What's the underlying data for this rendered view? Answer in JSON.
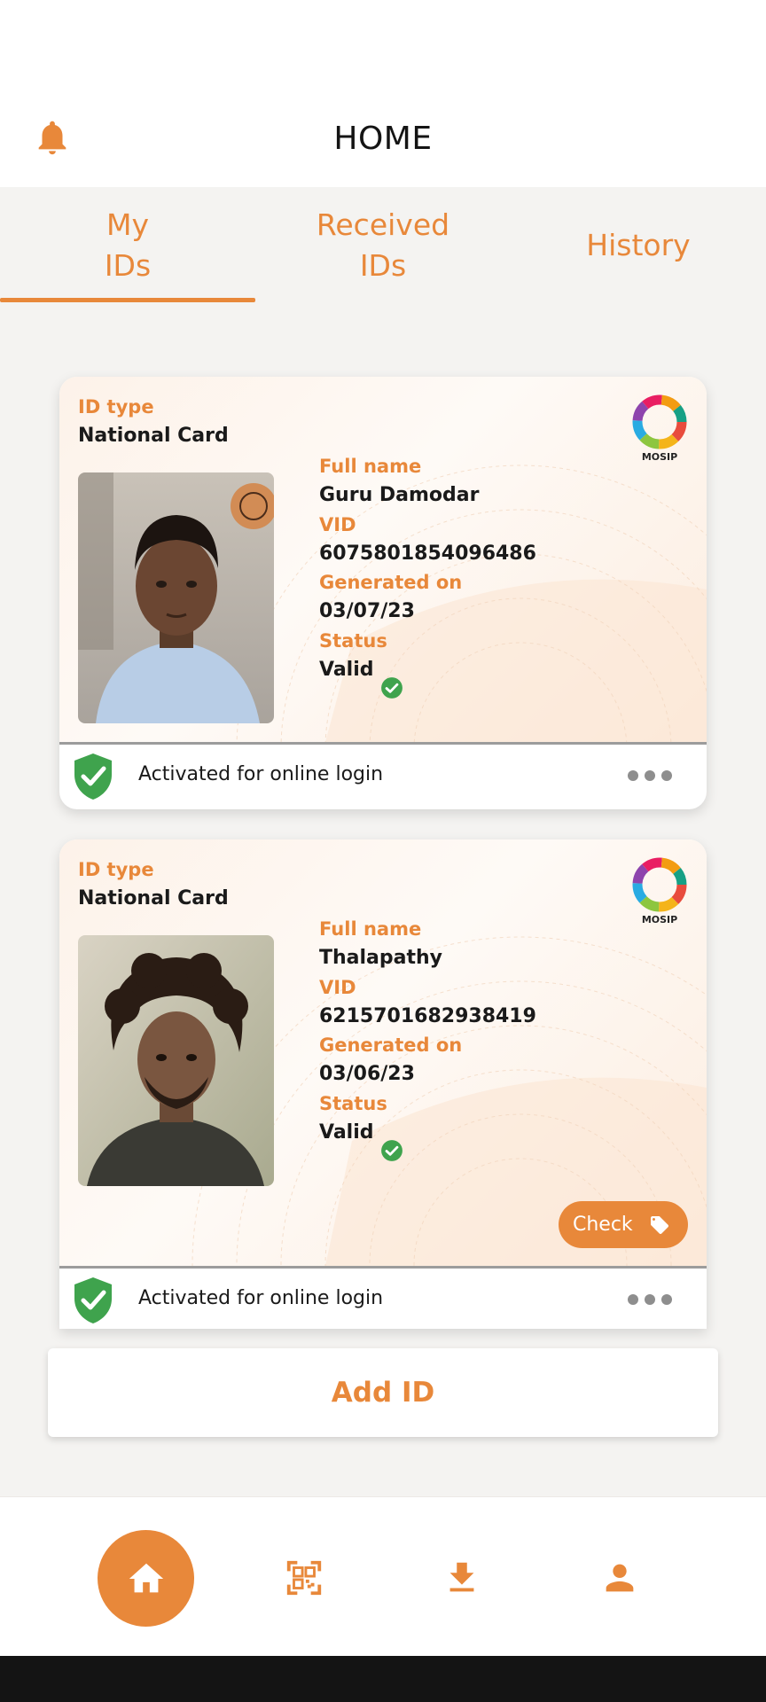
{
  "header": {
    "title": "HOME",
    "icon": "bell-icon"
  },
  "tabs": [
    {
      "label": "My\nIDs",
      "active": true
    },
    {
      "label": "Received\nIDs",
      "active": false
    },
    {
      "label": "History",
      "active": false
    }
  ],
  "cards": [
    {
      "id_type_label": "ID type",
      "id_type": "National Card",
      "logo_text": "MOSIP",
      "full_name_label": "Full name",
      "full_name": "Guru Damodar",
      "vid_label": "VID",
      "vid": "6075801854096486",
      "generated_label": "Generated on",
      "generated": "03/07/23",
      "status_label": "Status",
      "status": "Valid",
      "activation": "Activated for online login"
    },
    {
      "id_type_label": "ID type",
      "id_type": "National Card",
      "logo_text": "MOSIP",
      "full_name_label": "Full name",
      "full_name": "Thalapathy",
      "vid_label": "VID",
      "vid": "6215701682938419",
      "generated_label": "Generated on",
      "generated": "03/06/23",
      "status_label": "Status",
      "status": "Valid",
      "check_label": "Check",
      "activation": "Activated for online login"
    }
  ],
  "add_id": {
    "label": "Add ID"
  },
  "bottom_nav": [
    "home-icon",
    "qr-scan-icon",
    "download-icon",
    "profile-icon"
  ],
  "colors": {
    "accent": "#e8883a",
    "valid": "#3fa34d",
    "background": "#f4f3f1"
  }
}
